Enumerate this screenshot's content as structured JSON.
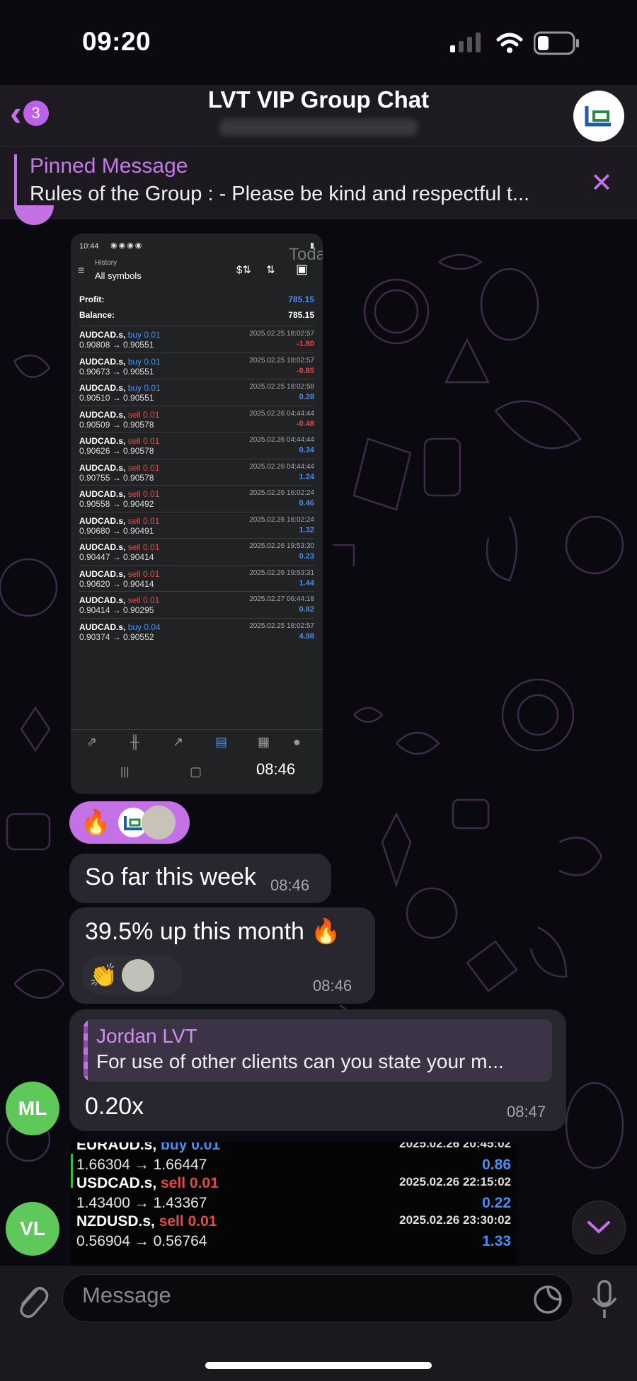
{
  "status_bar": {
    "time": "09:20"
  },
  "header": {
    "back_badge": "3",
    "title": "LVT VIP Group Chat"
  },
  "pinned": {
    "title": "Pinned Message",
    "text": "Rules of the Group : - Please be kind and respectful t..."
  },
  "screenshot": {
    "status_time": "10:44",
    "heading_small": "History",
    "heading": "All symbols",
    "profit_label": "Profit:",
    "profit_value": "785.15",
    "balance_label": "Balance:",
    "balance_value": "785.15",
    "time_overlay": "08:46",
    "today_label": "Today",
    "trades": [
      {
        "symbol": "AUDCAD.s,",
        "action": "buy 0.01",
        "prices": "0.90808 → 0.90551",
        "date": "2025.02.25 18:02:57",
        "pl": "-1.80"
      },
      {
        "symbol": "AUDCAD.s,",
        "action": "buy 0.01",
        "prices": "0.90673 → 0.90551",
        "date": "2025.02.25 18:02:57",
        "pl": "-0.85"
      },
      {
        "symbol": "AUDCAD.s,",
        "action": "buy 0.01",
        "prices": "0.90510 → 0.90551",
        "date": "2025.02.25 18:02:58",
        "pl": "0.28"
      },
      {
        "symbol": "AUDCAD.s,",
        "action": "sell 0.01",
        "prices": "0.90509 → 0.90578",
        "date": "2025.02.26 04:44:44",
        "pl": "-0.48"
      },
      {
        "symbol": "AUDCAD.s,",
        "action": "sell 0.01",
        "prices": "0.90626 → 0.90578",
        "date": "2025.02.26 04:44:44",
        "pl": "0.34"
      },
      {
        "symbol": "AUDCAD.s,",
        "action": "sell 0.01",
        "prices": "0.90755 → 0.90578",
        "date": "2025.02.26 04:44:44",
        "pl": "1.24"
      },
      {
        "symbol": "AUDCAD.s,",
        "action": "sell 0.01",
        "prices": "0.90558 → 0.90492",
        "date": "2025.02.26 16:02:24",
        "pl": "0.46"
      },
      {
        "symbol": "AUDCAD.s,",
        "action": "sell 0.01",
        "prices": "0.90680 → 0.90491",
        "date": "2025.02.26 16:02:24",
        "pl": "1.32"
      },
      {
        "symbol": "AUDCAD.s,",
        "action": "sell 0.01",
        "prices": "0.90447 → 0.90414",
        "date": "2025.02.26 19:53:30",
        "pl": "0.23"
      },
      {
        "symbol": "AUDCAD.s,",
        "action": "sell 0.01",
        "prices": "0.90620 → 0.90414",
        "date": "2025.02.26 19:53:31",
        "pl": "1.44"
      },
      {
        "symbol": "AUDCAD.s,",
        "action": "sell 0.01",
        "prices": "0.90414 → 0.90295",
        "date": "2025.02.27 06:44:18",
        "pl": "0.82"
      },
      {
        "symbol": "AUDCAD.s,",
        "action": "buy 0.04",
        "prices": "0.90374 → 0.90552",
        "date": "2025.02.25 18:02:57",
        "pl": "4.98"
      }
    ]
  },
  "reactions1": {
    "emoji": "🔥"
  },
  "messages": [
    {
      "text": "So far this week",
      "time": "08:46"
    },
    {
      "text": "39.5% up this month 🔥",
      "time": "08:46",
      "reaction": "👏"
    }
  ],
  "reply_message": {
    "quote_author": "Jordan LVT",
    "quote_text": "For use of other clients can you state your m...",
    "text": "0.20x",
    "time": "08:47",
    "sender_initials": "ML"
  },
  "second_sender": {
    "initials": "VL"
  },
  "trades2": [
    {
      "symbol": "EURAUD.s,",
      "action": "buy 0.01",
      "prices": "1.66304 → 1.66447",
      "date": "2025.02.26 20:45:02",
      "pl": "0.86"
    },
    {
      "symbol": "USDCAD.s,",
      "action": "sell 0.01",
      "prices": "1.43400 → 1.43367",
      "date": "2025.02.26 22:15:02",
      "pl": "0.22"
    },
    {
      "symbol": "NZDUSD.s,",
      "action": "sell 0.01",
      "prices": "0.56904 → 0.56764",
      "date": "2025.02.26 23:30:02",
      "pl": "1.33"
    }
  ],
  "input": {
    "placeholder": "Message"
  },
  "colors": {
    "accent": "#c471e6",
    "bubble": "#28262e",
    "buy": "#4a8ef5",
    "sell": "#e64a4a",
    "avatar_green": "#5fc85a"
  }
}
